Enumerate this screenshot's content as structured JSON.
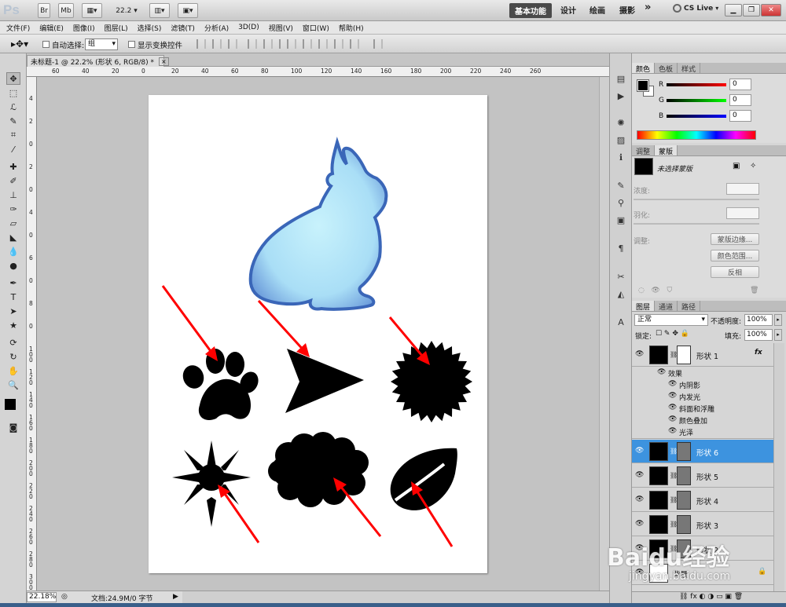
{
  "app": {
    "logo": "Ps",
    "zoom_dropdown": "22.2",
    "cs_live": "CS Live"
  },
  "workspaces": {
    "essentials": "基本功能",
    "design": "设计",
    "painting": "绘画",
    "photography": "摄影",
    "more": "»"
  },
  "menu": [
    "文件(F)",
    "编辑(E)",
    "图像(I)",
    "图层(L)",
    "选择(S)",
    "滤镜(T)",
    "分析(A)",
    "3D(D)",
    "视图(V)",
    "窗口(W)",
    "帮助(H)"
  ],
  "options": {
    "auto_select_label": "自动选择:",
    "auto_select_value": "组",
    "show_transform": "显示变换控件"
  },
  "document": {
    "tab_title": "未标题-1 @ 22.2% (形状 6, RGB/8) *",
    "close": "×"
  },
  "ruler_h": [
    "60",
    "40",
    "20",
    "0",
    "20",
    "40",
    "60",
    "80",
    "100",
    "120",
    "140",
    "160",
    "180",
    "200",
    "220",
    "240",
    "260"
  ],
  "ruler_v": [
    "4",
    "2",
    "0",
    "2",
    "0",
    "4",
    "0",
    "6",
    "0",
    "8",
    "0",
    "1 0 0",
    "1 2 0",
    "1 4 0",
    "1 6 0",
    "1 8 0",
    "2 0 0",
    "2 2 0",
    "2 4 0",
    "2 6 0",
    "2 8 0",
    "3 0 0"
  ],
  "status": {
    "zoom": "22.18%",
    "doc": "文档:24.9M/0 字节"
  },
  "color_panel": {
    "tabs": [
      "颜色",
      "色板",
      "样式"
    ],
    "r_label": "R",
    "g_label": "G",
    "b_label": "B",
    "r": "0",
    "g": "0",
    "b": "0"
  },
  "masks_panel": {
    "tabs": [
      "调整",
      "蒙版"
    ],
    "no_mask": "未选择蒙版",
    "density": "浓度:",
    "feather": "羽化:",
    "refine": "调整:",
    "mask_edge": "蒙版边缘...",
    "color_range": "颜色范围...",
    "invert": "反相"
  },
  "layers_panel": {
    "tabs": [
      "图层",
      "通道",
      "路径"
    ],
    "blend_mode": "正常",
    "opacity_label": "不透明度:",
    "opacity": "100%",
    "lock_label": "锁定:",
    "fill_label": "填充:",
    "fill": "100%",
    "layers": [
      {
        "name": "形状 1",
        "fx": "fx"
      },
      {
        "name": "形状 6",
        "selected": true
      },
      {
        "name": "形状 5"
      },
      {
        "name": "形状 4"
      },
      {
        "name": "形状 3"
      },
      {
        "name": "形状 2"
      },
      {
        "name": "背景"
      }
    ],
    "effects_label": "效果",
    "effects": [
      "内阴影",
      "内发光",
      "斜面和浮雕",
      "颜色叠加",
      "光泽"
    ]
  },
  "watermark": {
    "brand": "Baidu经验",
    "url": "jingyan.baidu.com"
  },
  "colors": {
    "selected_layer": "#3d93df",
    "arrow": "#ff0000",
    "rabbit_edge": "#3a66b8",
    "rabbit_fill": "#b8ecfa"
  }
}
